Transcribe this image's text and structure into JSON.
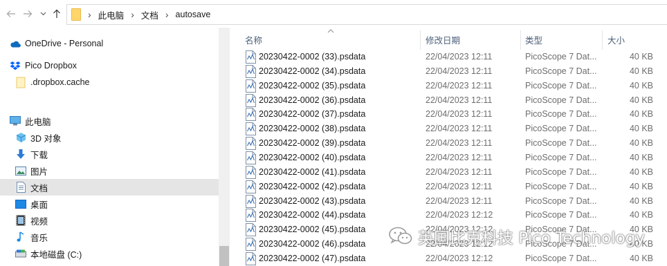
{
  "address_bar": {
    "back_icon": "arrow-left-icon",
    "forward_icon": "arrow-right-icon",
    "recent_icon": "chevron-down-icon",
    "up_icon": "arrow-up-icon",
    "folder_icon": "folder-icon",
    "crumbs": [
      "此电脑",
      "文档",
      "autosave"
    ],
    "separator": "›"
  },
  "nav_pane": {
    "items": [
      {
        "label": "OneDrive - Personal",
        "icon": "onedrive-cloud-icon"
      },
      {
        "label": "Pico Dropbox",
        "icon": "dropbox-icon"
      },
      {
        "label": ".dropbox.cache",
        "icon": "folder-icon"
      },
      {
        "label": "此电脑",
        "icon": "this-pc-icon"
      },
      {
        "label": "3D 对象",
        "icon": "3d-objects-icon"
      },
      {
        "label": "下载",
        "icon": "downloads-icon"
      },
      {
        "label": "图片",
        "icon": "pictures-icon"
      },
      {
        "label": "文档",
        "icon": "documents-icon",
        "selected": true
      },
      {
        "label": "桌面",
        "icon": "desktop-icon"
      },
      {
        "label": "视频",
        "icon": "videos-icon"
      },
      {
        "label": "音乐",
        "icon": "music-icon"
      },
      {
        "label": "本地磁盘 (C:)",
        "icon": "drive-icon"
      }
    ]
  },
  "file_list": {
    "columns": {
      "name": "名称",
      "date": "修改日期",
      "type": "类型",
      "size": "大小"
    },
    "sort_indicator": "chevron-up-icon",
    "rows": [
      {
        "name": "20230422-0002 (33).psdata",
        "date": "22/04/2023 12:11",
        "type": "PicoScope 7 Dat...",
        "size": "40 KB"
      },
      {
        "name": "20230422-0002 (34).psdata",
        "date": "22/04/2023 12:11",
        "type": "PicoScope 7 Dat...",
        "size": "40 KB"
      },
      {
        "name": "20230422-0002 (35).psdata",
        "date": "22/04/2023 12:11",
        "type": "PicoScope 7 Dat...",
        "size": "40 KB"
      },
      {
        "name": "20230422-0002 (36).psdata",
        "date": "22/04/2023 12:11",
        "type": "PicoScope 7 Dat...",
        "size": "40 KB"
      },
      {
        "name": "20230422-0002 (37).psdata",
        "date": "22/04/2023 12:11",
        "type": "PicoScope 7 Dat...",
        "size": "40 KB"
      },
      {
        "name": "20230422-0002 (38).psdata",
        "date": "22/04/2023 12:11",
        "type": "PicoScope 7 Dat...",
        "size": "40 KB"
      },
      {
        "name": "20230422-0002 (39).psdata",
        "date": "22/04/2023 12:11",
        "type": "PicoScope 7 Dat...",
        "size": "40 KB"
      },
      {
        "name": "20230422-0002 (40).psdata",
        "date": "22/04/2023 12:11",
        "type": "PicoScope 7 Dat...",
        "size": "40 KB"
      },
      {
        "name": "20230422-0002 (41).psdata",
        "date": "22/04/2023 12:11",
        "type": "PicoScope 7 Dat...",
        "size": "40 KB"
      },
      {
        "name": "20230422-0002 (42).psdata",
        "date": "22/04/2023 12:11",
        "type": "PicoScope 7 Dat...",
        "size": "40 KB"
      },
      {
        "name": "20230422-0002 (43).psdata",
        "date": "22/04/2023 12:11",
        "type": "PicoScope 7 Dat...",
        "size": "40 KB"
      },
      {
        "name": "20230422-0002 (44).psdata",
        "date": "22/04/2023 12:12",
        "type": "PicoScope 7 Dat...",
        "size": "40 KB"
      },
      {
        "name": "20230422-0002 (45).psdata",
        "date": "22/04/2023 12:12",
        "type": "PicoScope 7 Dat...",
        "size": "40 KB"
      },
      {
        "name": "20230422-0002 (46).psdata",
        "date": "22/04/2023 12:12",
        "type": "PicoScope 7 Dat...",
        "size": "40 KB"
      },
      {
        "name": "20230422-0002 (47).psdata",
        "date": "22/04/2023 12:12",
        "type": "PicoScope 7 Dat...",
        "size": "40 KB"
      }
    ],
    "file_icon": "psdata-file-icon"
  },
  "watermark": {
    "icon": "wechat-icon",
    "text": "英国比克科技 Pico Technology"
  },
  "colors": {
    "selected_bg": "#e5e5e5",
    "header_text": "#4c607a",
    "secondary_text": "#6d6d6d",
    "folder_yellow": "#ffd66b",
    "onedrive_blue": "#0f6cbd"
  }
}
